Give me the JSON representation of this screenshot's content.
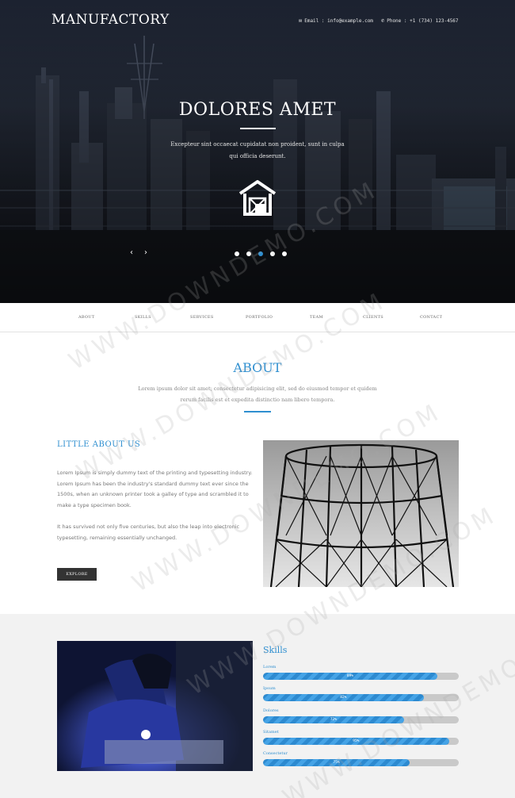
{
  "header": {
    "brand": "MANUFACTORY",
    "email": "Email : info@example.com",
    "phone": "Phone : +1 (734) 123-4567",
    "email_icon": "envelope-icon",
    "phone_icon": "phone-icon"
  },
  "hero": {
    "title": "DOLORES AMET",
    "text": "Excepteur sint occaecat cupidatat non proident, sunt in culpa qui officia deserunt.",
    "icon": "warehouse-icon",
    "prev_arrow": "‹",
    "next_arrow": "›",
    "slides": 5,
    "active_slide": 3
  },
  "nav": {
    "items": [
      "ABOUT",
      "SKILLS",
      "SERVICES",
      "PORTFOLIO",
      "TEAM",
      "CLIENTS",
      "CONTACT"
    ]
  },
  "about": {
    "title": "ABOUT",
    "text": "Lorem ipsum dolor sit amet, consectetur adipisicing elit, sed do eiusmod tempor et quidem rerum facilis est et expedita distinctio nam libero tempora.",
    "subtitle": "LITTLE ABOUT US",
    "p1": "Lorem Ipsum is simply dummy text of the printing and typesetting industry. Lorem Ipsum has been the industry's standard dummy text ever since the 1500s, when an unknown printer took a galley of type and scrambled it to make a type specimen book.",
    "p2": "It has survived not only five centuries, but also the leap into electronic typesetting, remaining essentially unchanged.",
    "button": "EXPLORE"
  },
  "skills": {
    "title": "Skills",
    "items": [
      {
        "name": "Lorem",
        "label": "89%",
        "percent": 89
      },
      {
        "name": "Ipsum",
        "label": "82%",
        "percent": 82
      },
      {
        "name": "Dolores",
        "label": "72%",
        "percent": 72
      },
      {
        "name": "Sitamet",
        "label": "95%",
        "percent": 95
      },
      {
        "name": "Consectetur",
        "label": "75%",
        "percent": 75
      }
    ]
  },
  "watermark": "WWW.DOWNDEMO.COM",
  "colors": {
    "accent": "#2f8fd0",
    "button": "#333333",
    "skills_bg": "#f2f2f2"
  }
}
